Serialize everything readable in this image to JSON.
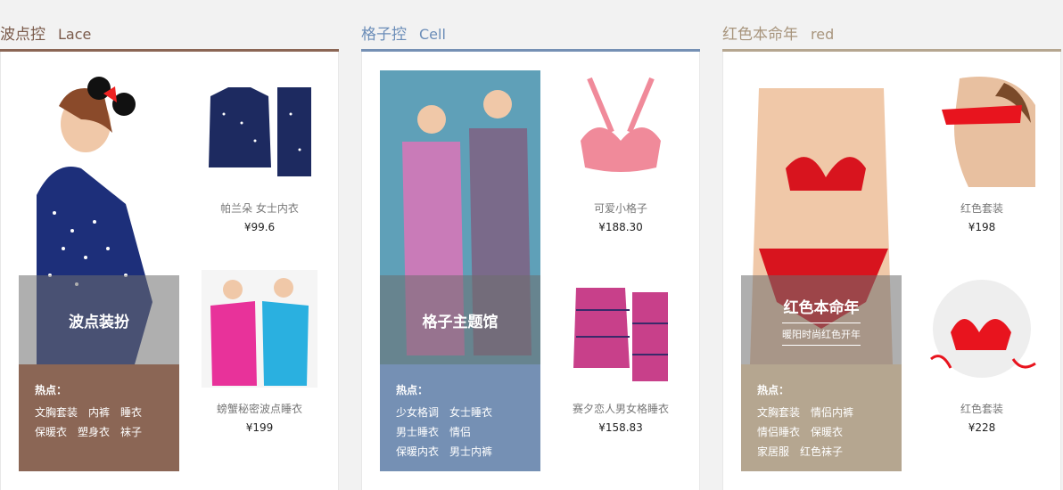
{
  "sections": [
    {
      "title_cn": "波点控",
      "title_en": "Lace",
      "banner_title": "波点装扮",
      "banner_sub": "",
      "hot_title": "热点：",
      "hot_rows": [
        [
          "文胸套装",
          "内裤",
          "睡衣"
        ],
        [
          "保暖衣",
          "塑身衣",
          "袜子"
        ]
      ],
      "products": [
        {
          "name": "帕兰朵 女士内衣",
          "price": "¥99.6"
        },
        {
          "name": "螃蟹秘密波点睡衣",
          "price": "¥199"
        }
      ]
    },
    {
      "title_cn": "格子控",
      "title_en": "Cell",
      "banner_title": "格子主题馆",
      "banner_sub": "",
      "hot_title": "热点：",
      "hot_rows": [
        [
          "少女格调",
          "女士睡衣"
        ],
        [
          "男士睡衣",
          "情侣"
        ],
        [
          "保暖内衣",
          "男士内裤"
        ]
      ],
      "products": [
        {
          "name": "可爱小格子",
          "price": "¥188.30"
        },
        {
          "name": "赛夕恋人男女格睡衣",
          "price": "¥158.83"
        }
      ]
    },
    {
      "title_cn": "红色本命年",
      "title_en": "red",
      "banner_title": "红色本命年",
      "banner_sub": "暖阳时尚红色开年",
      "hot_title": "热点：",
      "hot_rows": [
        [
          "文胸套装",
          "情侣内裤"
        ],
        [
          "情侣睡衣",
          "保暖衣"
        ],
        [
          "家居服",
          "红色袜子"
        ]
      ],
      "products": [
        {
          "name": "红色套装",
          "price": "¥198"
        },
        {
          "name": "红色套装",
          "price": "¥228"
        }
      ]
    }
  ]
}
